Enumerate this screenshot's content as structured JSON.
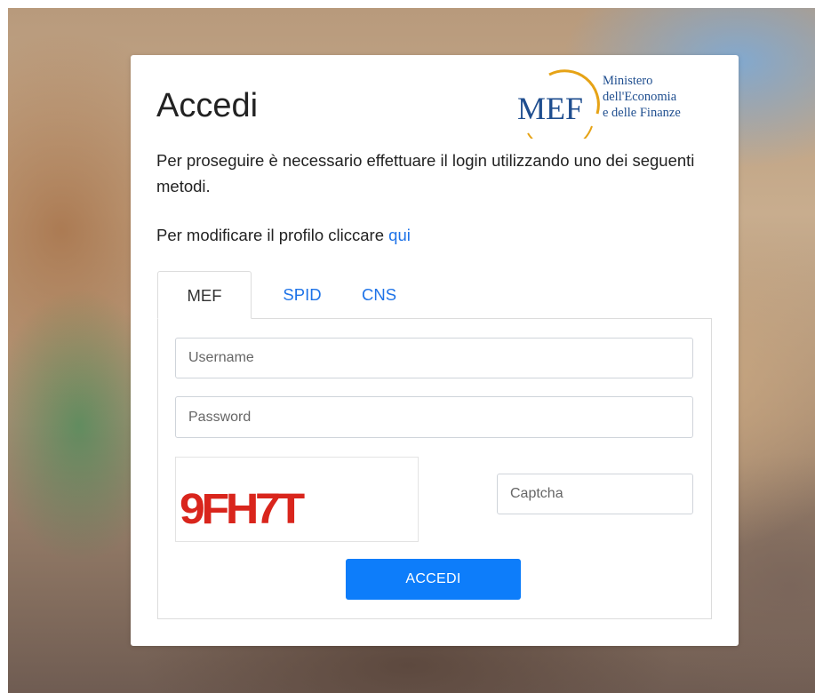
{
  "login": {
    "title": "Accedi",
    "intro": "Per proseguire è necessario effettuare il login utilizzando uno dei seguenti metodi.",
    "profile_prefix": "Per modificare il profilo cliccare",
    "profile_link": "qui",
    "tabs": [
      {
        "label": "MEF",
        "active": true
      },
      {
        "label": "SPID",
        "active": false
      },
      {
        "label": "CNS",
        "active": false
      }
    ],
    "username_placeholder": "Username",
    "password_placeholder": "Password",
    "captcha_image_text": "9FH7T",
    "captcha_placeholder": "Captcha",
    "submit_label": "ACCEDI"
  },
  "logo": {
    "acronym": "MEF",
    "line1": "Ministero",
    "line2": "dell'Economia",
    "line3": "e delle Finanze"
  },
  "colors": {
    "link": "#1e73e8",
    "button": "#0d7dfa",
    "captcha": "#d9251c",
    "logo_blue": "#1f4e8f",
    "logo_gold": "#e6a316"
  }
}
